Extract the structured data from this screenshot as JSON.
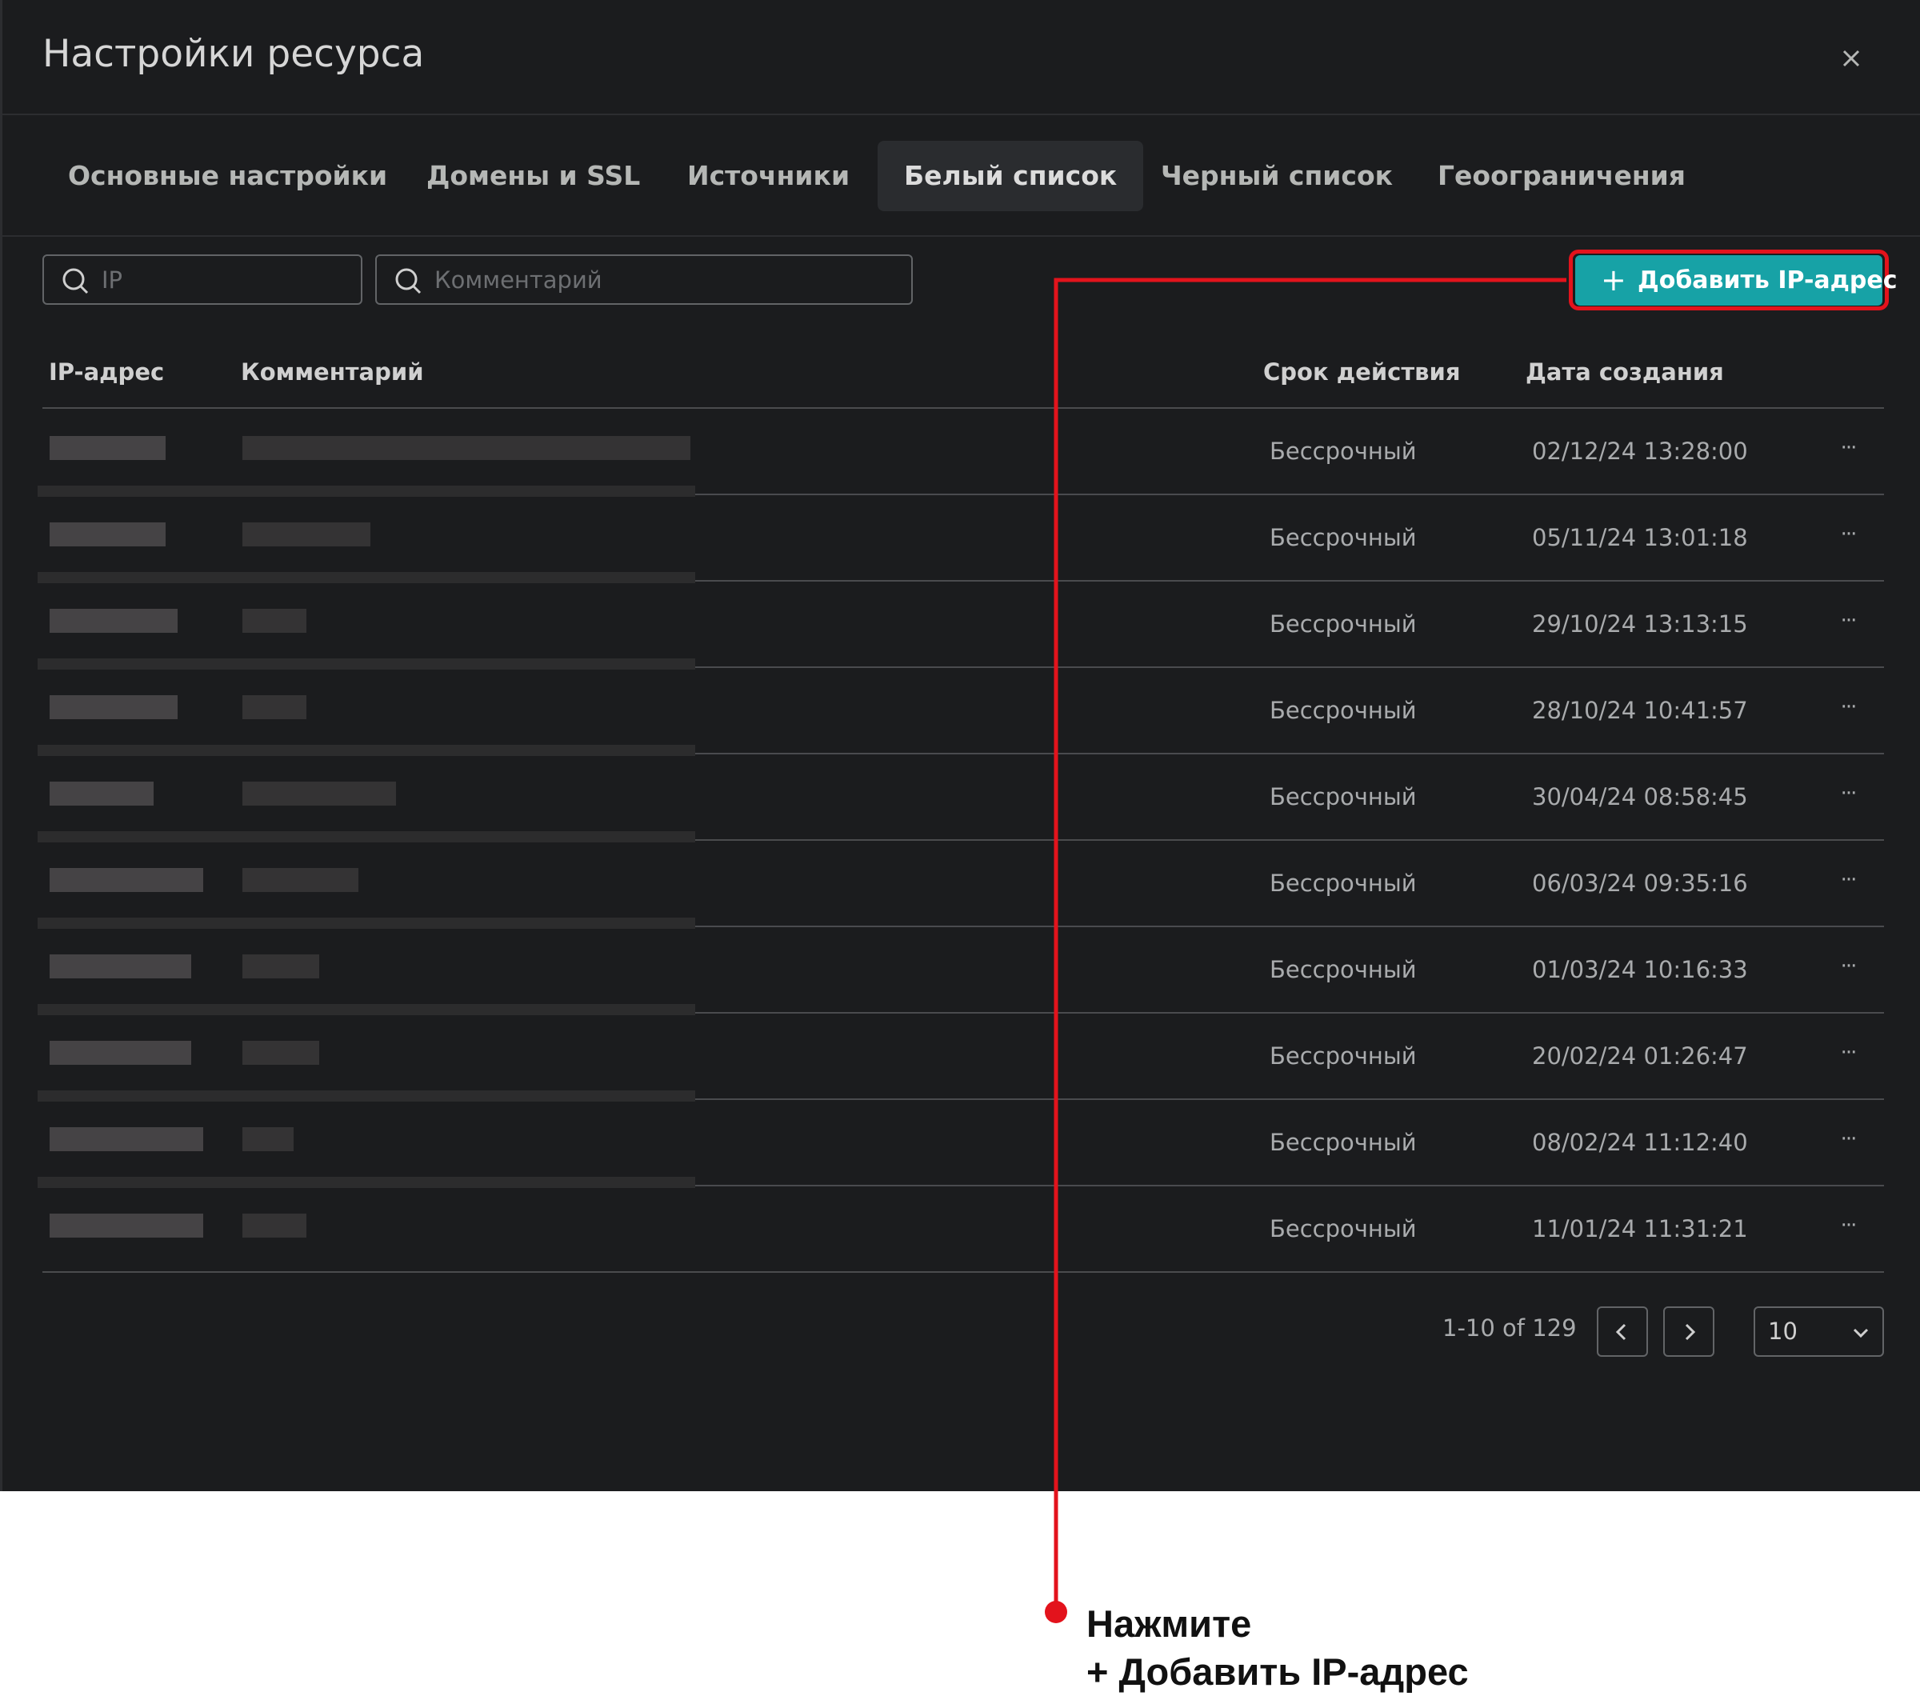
{
  "dialog": {
    "title": "Настройки ресурса"
  },
  "tabs": [
    {
      "label": "Основные настройки",
      "active": false
    },
    {
      "label": "Домены и SSL",
      "active": false
    },
    {
      "label": "Источники",
      "active": false
    },
    {
      "label": "Белый список",
      "active": true
    },
    {
      "label": "Черный список",
      "active": false
    },
    {
      "label": "Геоограничения",
      "active": false
    }
  ],
  "filters": {
    "ip_placeholder": "IP",
    "comment_placeholder": "Комментарий"
  },
  "add_button": {
    "label": "Добавить IP-адрес",
    "color": "#17a2a6"
  },
  "table": {
    "headers": {
      "ip": "IP-адрес",
      "comment": "Комментарий",
      "expiry": "Срок действия",
      "created": "Дата создания"
    },
    "rows": [
      {
        "expiry": "Бессрочный",
        "created": "02/12/24 13:28:00"
      },
      {
        "expiry": "Бессрочный",
        "created": "05/11/24 13:01:18"
      },
      {
        "expiry": "Бессрочный",
        "created": "29/10/24 13:13:15"
      },
      {
        "expiry": "Бессрочный",
        "created": "28/10/24 10:41:57"
      },
      {
        "expiry": "Бессрочный",
        "created": "30/04/24 08:58:45"
      },
      {
        "expiry": "Бессрочный",
        "created": "06/03/24 09:35:16"
      },
      {
        "expiry": "Бессрочный",
        "created": "01/03/24 10:16:33"
      },
      {
        "expiry": "Бессрочный",
        "created": "20/02/24 01:26:47"
      },
      {
        "expiry": "Бессрочный",
        "created": "08/02/24 11:12:40"
      },
      {
        "expiry": "Бессрочный",
        "created": "11/01/24 11:31:21"
      }
    ]
  },
  "pagination": {
    "range": "1-10 of 129",
    "per_page": "10"
  },
  "callout": {
    "line1": "Нажмите",
    "line2": "+ Добавить IP-адрес",
    "color": "#e3131c"
  }
}
